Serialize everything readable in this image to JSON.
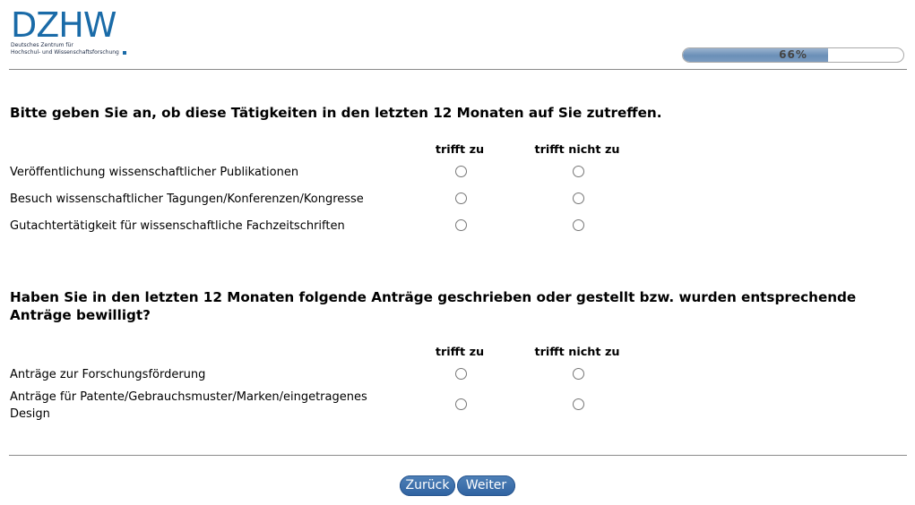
{
  "logo": {
    "text": "DZHW",
    "line1": "Deutsches Zentrum für",
    "line2": "Hochschul- und Wissenschaftsforschung"
  },
  "progress": {
    "value": 0.66,
    "label": "66%"
  },
  "question1": {
    "title": "Bitte geben Sie an, ob diese Tätigkeiten in den letzten 12 Monaten auf Sie zutreffen.",
    "col_yes": "trifft zu",
    "col_no": "trifft nicht zu",
    "rows": [
      "Veröffentlichung wissenschaftlicher Publikationen",
      "Besuch wissenschaftlicher Tagungen/Konferenzen/Kongresse",
      "Gutachtertätigkeit für wissenschaftliche Fachzeitschriften"
    ]
  },
  "question2": {
    "title": "Haben Sie in den letzten 12 Monaten folgende Anträge geschrieben oder gestellt bzw. wurden entsprechende Anträge bewilligt?",
    "col_yes": "trifft zu",
    "col_no": "trifft nicht zu",
    "rows": [
      "Anträge zur Forschungsförderung",
      "Anträge für Patente/Gebrauchsmuster/Marken/eingetragenes Design"
    ]
  },
  "nav": {
    "back": "Zurück",
    "next": "Weiter"
  }
}
